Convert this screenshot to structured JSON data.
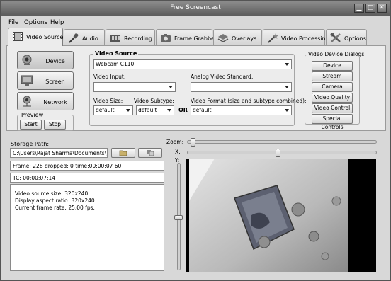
{
  "window": {
    "title": "Free Screencast"
  },
  "menu": [
    "File",
    "Options",
    "Help"
  ],
  "tabs": [
    {
      "label": "Video Source",
      "icon": "film-icon",
      "active": true
    },
    {
      "label": "Audio",
      "icon": "microphone-icon",
      "active": false
    },
    {
      "label": "Recording",
      "icon": "film-reel-icon",
      "active": false
    },
    {
      "label": "Frame Grabber",
      "icon": "camera-icon",
      "active": false
    },
    {
      "label": "Overlays",
      "icon": "layers-icon",
      "active": false
    },
    {
      "label": "Video Processing",
      "icon": "magic-wand-icon",
      "active": false
    },
    {
      "label": "Options",
      "icon": "tools-icon",
      "active": false
    }
  ],
  "source_buttons": [
    {
      "label": "Device",
      "icon": "webcam-icon",
      "selected": true
    },
    {
      "label": "Screen",
      "icon": "monitor-icon",
      "selected": false
    },
    {
      "label": "Network",
      "icon": "network-icon",
      "selected": false
    }
  ],
  "preview": {
    "title": "Preview",
    "start": "Start",
    "stop": "Stop"
  },
  "video_source": {
    "title": "Video Source",
    "device": "Webcam C110",
    "video_input_label": "Video Input:",
    "video_input_value": "",
    "analog_standard_label": "Analog Video Standard:",
    "analog_standard_value": "",
    "video_size_label": "Video Size:",
    "video_size_value": "default",
    "video_subtype_label": "Video Subtype:",
    "video_subtype_value": "default",
    "or_label": "OR",
    "video_format_label": "Video Format (size and subtype combined):",
    "video_format_value": "default"
  },
  "dialogs": {
    "title": "Video Device Dialogs",
    "buttons": [
      "Device",
      "Stream",
      "Camera Control",
      "Video Quality",
      "Video Control",
      "Special Controls"
    ]
  },
  "storage": {
    "label": "Storage Path:",
    "path": "C:\\Users\\Rajat Sharma\\Documents\\",
    "frame_info": "Frame: 228 dropped: 0 time:00:00:07 60",
    "tc": "TC: 00:00:07:14",
    "info_lines": [
      "Video source size: 320x240",
      "Display aspect ratio: 320x240",
      "Current frame rate: 25.00 fps."
    ]
  },
  "sliders": {
    "zoom_label": "Zoom:",
    "x_label": "X:",
    "y_label": "Y:",
    "zoom_value": 0.02,
    "x_value": 0.48,
    "y_value": 0.51
  }
}
